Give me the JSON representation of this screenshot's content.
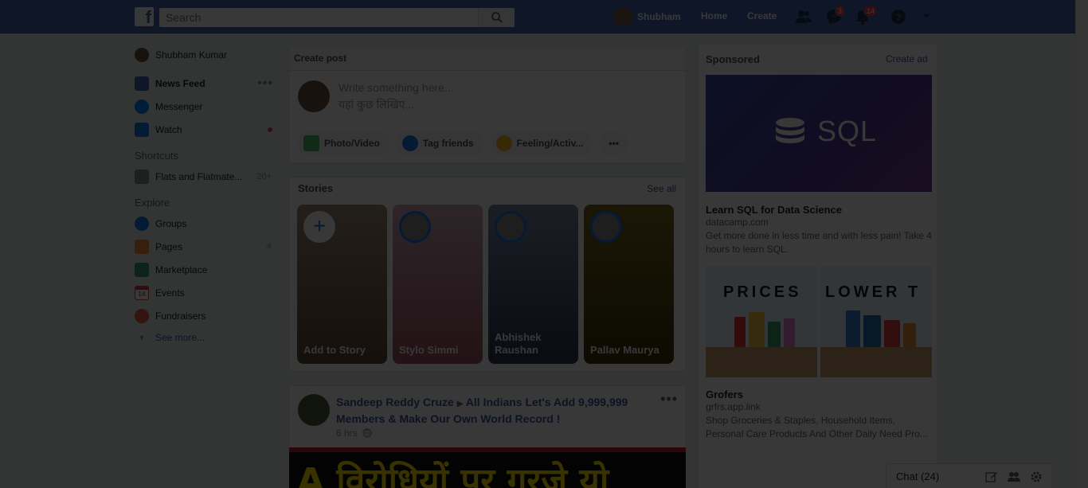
{
  "topbar": {
    "logo": "f",
    "search_placeholder": "Search",
    "profile_name": "Shubham",
    "home_label": "Home",
    "create_label": "Create",
    "messages_badge": "3",
    "notifications_badge": "14"
  },
  "left_nav": {
    "profile": "Shubham Kumar",
    "main_items": [
      {
        "label": "News Feed",
        "icon": "news-feed-icon"
      },
      {
        "label": "Messenger",
        "icon": "messenger-icon"
      },
      {
        "label": "Watch",
        "icon": "watch-icon"
      }
    ],
    "more_dots": "•••",
    "shortcuts_heading": "Shortcuts",
    "shortcuts": [
      {
        "label": "Flats and Flatmate...",
        "count": "20+"
      }
    ],
    "explore_heading": "Explore",
    "explore_items": [
      {
        "label": "Groups",
        "icon": "groups-icon"
      },
      {
        "label": "Pages",
        "icon": "pages-icon",
        "count": "4"
      },
      {
        "label": "Marketplace",
        "icon": "marketplace-icon"
      },
      {
        "label": "Events",
        "icon": "events-icon",
        "day": "14"
      },
      {
        "label": "Fundraisers",
        "icon": "fundraisers-icon"
      }
    ],
    "see_more": "See more..."
  },
  "create_post": {
    "header": "Create post",
    "placeholder_en": "Write something here...",
    "placeholder_hi": "यहां कुछ लिखिए...",
    "actions": {
      "photo": "Photo/Video",
      "tag": "Tag friends",
      "feeling": "Feeling/Activ...",
      "more": "•••"
    }
  },
  "stories": {
    "title": "Stories",
    "see_all": "See all",
    "items": [
      {
        "name": "Add to Story"
      },
      {
        "name": "Stylo Simmi"
      },
      {
        "name": "Abhishek Raushan"
      },
      {
        "name": "Pallav Maurya"
      }
    ]
  },
  "post": {
    "author": "Sandeep Reddy Cruze",
    "arrow": "▶",
    "group": "All Indians Let's Add 9,999,999 Members & Make Our Own World Record !",
    "time": "6 hrs",
    "menu": "•••",
    "image_text": "A विरोधियों पर गरजे यो"
  },
  "sponsored": {
    "title": "Sponsored",
    "create_ad": "Create ad",
    "ads": [
      {
        "image_text": "SQL",
        "title": "Learn SQL for Data Science",
        "domain": "datacamp.com",
        "description": "Get more done in less time and with less pain! Take 4 hours to learn SQL."
      },
      {
        "image_text_left": "PRICES",
        "image_text_right": "LOWER T",
        "title": "Grofers",
        "domain": "grfrs.app.link",
        "description": "Shop Groceries & Staples, Household Items, Personal Care Products And Other Daily Need Pro..."
      }
    ]
  },
  "chat": {
    "label": "Chat (24)"
  },
  "colors": {
    "brand_blue": "#4267b2",
    "link_blue": "#365899",
    "badge_red": "#fa3e3e",
    "overlay": "rgba(0,0,0,0.78)"
  }
}
